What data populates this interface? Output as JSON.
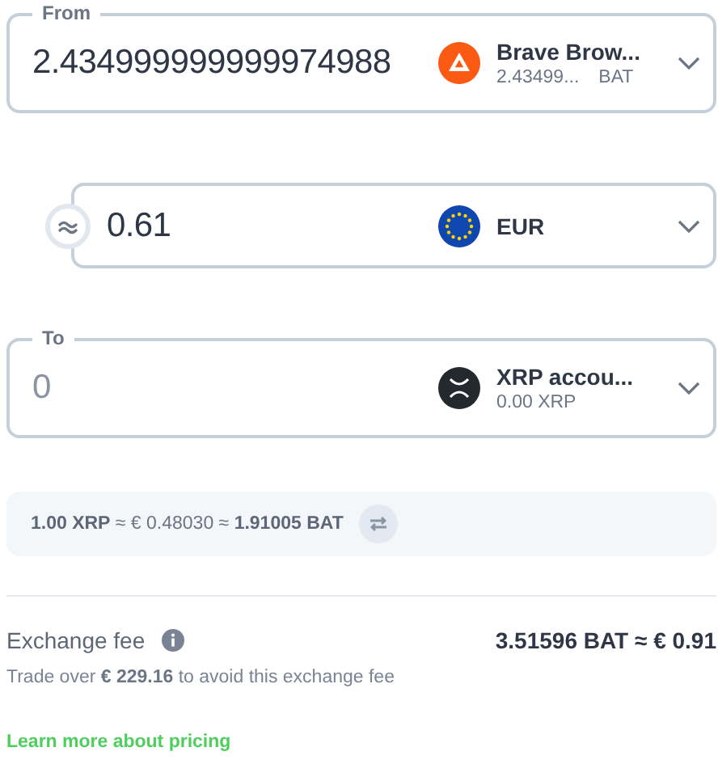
{
  "from": {
    "label": "From",
    "value": "2.434999999999974988",
    "asset": {
      "kind": "bat",
      "name": "Brave Brow...",
      "amount": "2.43499...",
      "code": "BAT"
    }
  },
  "converter": {
    "value": "0.61",
    "asset": {
      "kind": "eur",
      "name": "EUR"
    }
  },
  "to": {
    "label": "To",
    "placeholder": "0",
    "asset": {
      "kind": "xrp",
      "name": "XRP accou...",
      "amount": "0.00 XRP"
    }
  },
  "rate": {
    "text": "**1.00 XRP** ≈ € 0.48030 ≈ **1.91005 BAT**"
  },
  "fee": {
    "label": "Exchange fee",
    "value": "3.51596 BAT ≈ € 0.91",
    "note": "Trade over **€ 229.16** to avoid this exchange fee"
  },
  "link": "Learn more about pricing"
}
